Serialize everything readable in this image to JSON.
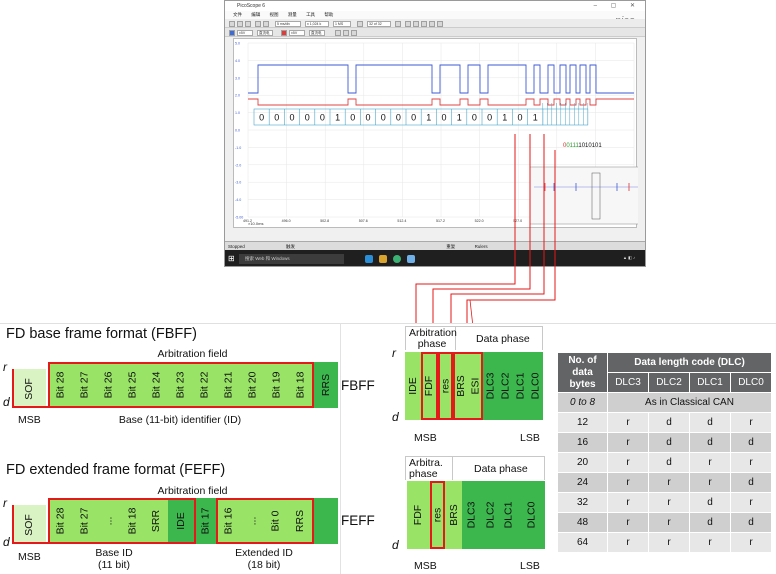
{
  "scope": {
    "title": "PicoScope 6",
    "menu": [
      "文件",
      "编辑",
      "视图",
      "测量",
      "工具",
      "帮助"
    ],
    "toolbar": {
      "timebase": "5 ms/div",
      "zoom": "x 1,024 k",
      "samples": "1 MS",
      "buffer": "32 of 32",
      "channel_a": "±5V",
      "channel_b": "直流电"
    },
    "logo": "pico",
    "y_ticks": [
      "5.0",
      "4.0",
      "3.0",
      "2.0",
      "1.0",
      "0.0",
      "-1.0",
      "-2.0",
      "-3.0",
      "-4.0",
      "-5.00"
    ],
    "x_ticks": [
      "491.2",
      "496.0",
      "502.8",
      "507.6",
      "512.4",
      "517.2",
      "522.0",
      "527.0",
      "532.0",
      "537.1",
      "542.0"
    ],
    "x_unit": "×10.0ms",
    "bits": [
      "0",
      "0",
      "0",
      "0",
      "0",
      "1",
      "0",
      "0",
      "0",
      "0",
      "0",
      "1",
      "0",
      "1",
      "0",
      "0",
      "1",
      "0",
      "1"
    ],
    "bit_string_green": "0111",
    "bit_string_black": "1010101",
    "bit_string_lead": "0",
    "status": {
      "state": "Stopped",
      "trigger": "触发",
      "mode": "重复",
      "rulers": "Rulers"
    },
    "taskbar": {
      "search": "搜索 Web 和 Windows"
    }
  },
  "fbff": {
    "heading": "FD base frame format (FBFF)",
    "arbitration_label": "Arbitration field",
    "cells": [
      "SOF",
      "Bit 28",
      "Bit 27",
      "Bit 26",
      "Bit 25",
      "Bit 24",
      "Bit 23",
      "Bit 22",
      "Bit 21",
      "Bit 20",
      "Bit 19",
      "Bit 18",
      "RRS"
    ],
    "side_label": "FBFF",
    "msb": "MSB",
    "id_label": "Base (11-bit) identifier (ID)",
    "r": "r",
    "d": "d"
  },
  "feff": {
    "heading": "FD extended frame format (FEFF)",
    "arbitration_label": "Arbitration field",
    "cells": [
      "SOF",
      "Bit 28",
      "Bit 27",
      "...",
      "Bit 18",
      "SRR",
      "IDE",
      "Bit 17",
      "Bit 16",
      "...",
      "Bit 0",
      "RRS"
    ],
    "side_label": "FEFF",
    "msb": "MSB",
    "base_id_label": "Base ID",
    "base_id_sub": "(11 bit)",
    "ext_id_label": "Extended ID",
    "ext_id_sub": "(18 bit)",
    "r": "r",
    "d": "d"
  },
  "ctrl_top": {
    "arb_label": "Arbitration phase",
    "data_label": "Data phase",
    "cells": [
      "IDE",
      "FDF",
      "res",
      "BRS",
      "ESI",
      "DLC3",
      "DLC2",
      "DLC1",
      "DLC0"
    ],
    "msb": "MSB",
    "lsb": "LSB",
    "r": "r",
    "d": "d"
  },
  "ctrl_bottom": {
    "arb_label": "Arbitra. phase",
    "data_label": "Data phase",
    "cells": [
      "FDF",
      "res",
      "BRS",
      "DLC3",
      "DLC2",
      "DLC1",
      "DLC0"
    ],
    "msb": "MSB",
    "lsb": "LSB",
    "d": "d"
  },
  "dlc_table": {
    "col0_header": "No. of data bytes",
    "group_header": "Data length code (DLC)",
    "sub_headers": [
      "DLC3",
      "DLC2",
      "DLC1",
      "DLC0"
    ],
    "first_row": {
      "bytes_a": "0",
      "bytes_to": "to",
      "bytes_b": "8",
      "text": "As in Classical CAN"
    },
    "rows": [
      {
        "bytes": "12",
        "dlc": [
          "r",
          "d",
          "d",
          "r"
        ]
      },
      {
        "bytes": "16",
        "dlc": [
          "r",
          "d",
          "d",
          "d"
        ]
      },
      {
        "bytes": "20",
        "dlc": [
          "r",
          "d",
          "r",
          "r"
        ]
      },
      {
        "bytes": "24",
        "dlc": [
          "r",
          "r",
          "r",
          "d"
        ]
      },
      {
        "bytes": "32",
        "dlc": [
          "r",
          "r",
          "d",
          "r"
        ]
      },
      {
        "bytes": "48",
        "dlc": [
          "r",
          "r",
          "d",
          "d"
        ]
      },
      {
        "bytes": "64",
        "dlc": [
          "r",
          "r",
          "r",
          "r"
        ]
      }
    ]
  }
}
